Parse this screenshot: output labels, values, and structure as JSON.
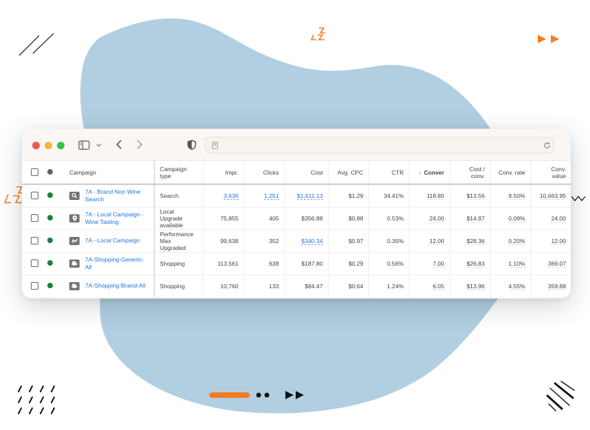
{
  "colors": {
    "blob": "#b1cfe1",
    "accent_orange": "#f47c1c",
    "link_blue": "#1a73e8",
    "status_green": "#188038"
  },
  "browser": {
    "traffic_lights": [
      "close",
      "minimize",
      "zoom"
    ],
    "icons": {
      "sidebar": "sidebar-icon",
      "sidebar_menu": "chevron-down-icon",
      "back": "chevron-left-icon",
      "forward": "chevron-right-icon",
      "privacy": "shield-icon",
      "page": "page-icon",
      "reload": "reload-icon"
    },
    "url": ""
  },
  "table": {
    "columns": [
      {
        "key": "campaign",
        "label": "Campaign"
      },
      {
        "key": "type",
        "label": "Campaign type"
      },
      {
        "key": "impr",
        "label": "Impr."
      },
      {
        "key": "clicks",
        "label": "Clicks"
      },
      {
        "key": "cost",
        "label": "Cost"
      },
      {
        "key": "avg_cpc",
        "label": "Avg. CPC"
      },
      {
        "key": "ctr",
        "label": "CTR"
      },
      {
        "key": "conversions",
        "label": "Conver",
        "sorted": "descending",
        "sort_icon": "arrow-down-icon"
      },
      {
        "key": "cost_per_conv",
        "label": "Cost / conv."
      },
      {
        "key": "conv_rate",
        "label": "Conv. rate"
      },
      {
        "key": "conv_value",
        "label": "Conv. value"
      }
    ],
    "rows": [
      {
        "icon": "search-campaign-icon",
        "status": "enabled",
        "campaign": "7A - Brand Non Wine Search",
        "type": "Search",
        "impr": "3,636",
        "clicks": "1,251",
        "cost": "$1,611.13",
        "avg_cpc": "$1.29",
        "ctr": "34.41%",
        "conversions": "118.80",
        "cost_per_conv": "$13.56",
        "conv_rate": "9.50%",
        "conv_value": "10,663.95"
      },
      {
        "icon": "location-pin-icon",
        "status": "enabled",
        "campaign": "7A - Local Campaign - Wine Tasting",
        "type": "Local Upgrade available",
        "impr": "75,855",
        "clicks": "405",
        "cost": "$356.88",
        "avg_cpc": "$0.88",
        "ctr": "0.53%",
        "conversions": "24.00",
        "cost_per_conv": "$14.87",
        "conv_rate": "0.09%",
        "conv_value": "24.00"
      },
      {
        "icon": "performance-max-icon",
        "status": "enabled",
        "campaign": "7A - Local Campaign",
        "type": "Performance Max Upgraded",
        "impr": "99,638",
        "clicks": "352",
        "cost": "$340.34",
        "avg_cpc": "$0.97",
        "ctr": "0.35%",
        "conversions": "12.00",
        "cost_per_conv": "$28.36",
        "conv_rate": "0.20%",
        "conv_value": "12.00"
      },
      {
        "icon": "shopping-tag-icon",
        "status": "enabled",
        "campaign": "7A-Shopping-Generic-All",
        "type": "Shopping",
        "impr": "113,561",
        "clicks": "638",
        "cost": "$187.80",
        "avg_cpc": "$0.29",
        "ctr": "0.56%",
        "conversions": "7.00",
        "cost_per_conv": "$26.83",
        "conv_rate": "1.10%",
        "conv_value": "369.07"
      },
      {
        "icon": "shopping-tag-icon",
        "status": "enabled",
        "campaign": "7A-Shopping-Brand-All",
        "type": "Shopping",
        "impr": "10,760",
        "clicks": "133",
        "cost": "$84.47",
        "avg_cpc": "$0.64",
        "ctr": "1.24%",
        "conversions": "6.05",
        "cost_per_conv": "$13.96",
        "conv_rate": "4.55%",
        "conv_value": "359.88"
      }
    ]
  },
  "decorations": [
    "double-slash-icon",
    "zigzag-icon",
    "fast-forward-icon",
    "slash-grid-icon",
    "progress-pill",
    "dots-icon",
    "diagonal-lines-icon",
    "wave-icon"
  ]
}
